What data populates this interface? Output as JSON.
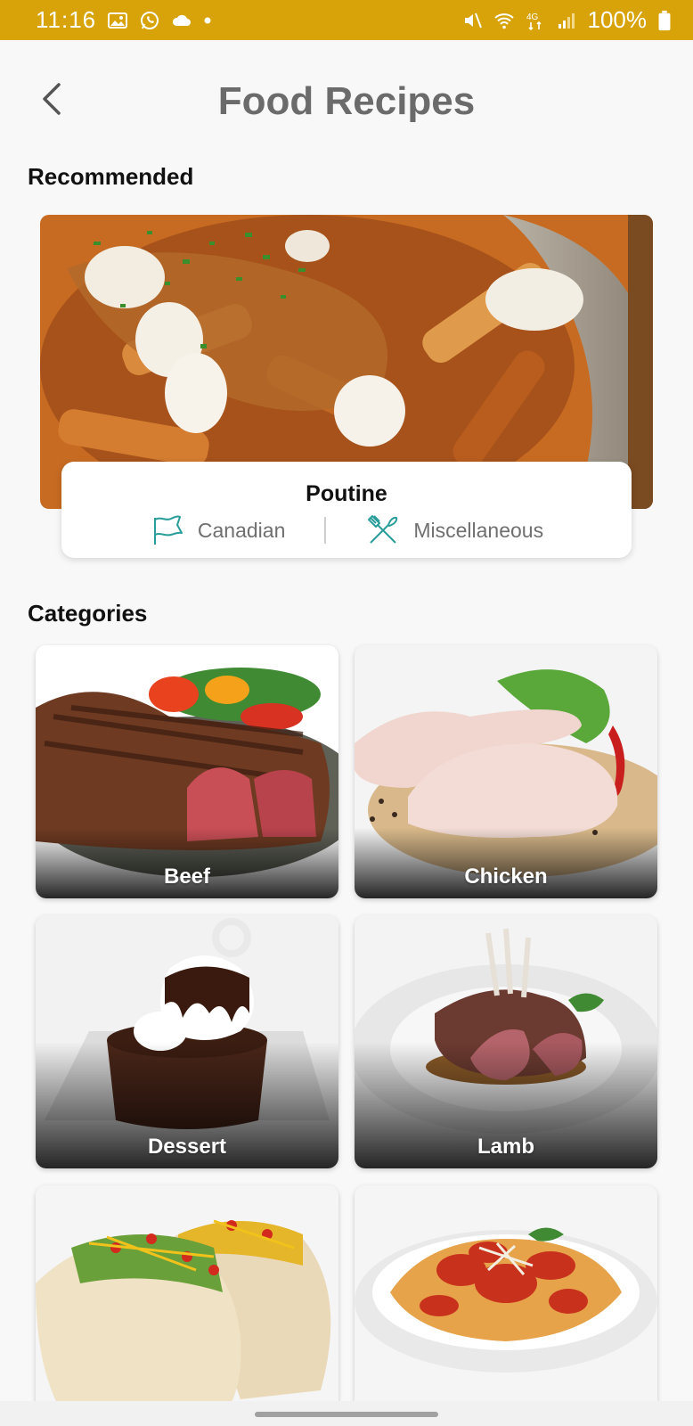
{
  "status_bar": {
    "time": "11:16",
    "battery": "100%",
    "network": "4G",
    "left_icons": [
      "image-icon",
      "whatsapp-icon",
      "cloud-icon",
      "dot-icon"
    ],
    "right_icons": [
      "mute-icon",
      "wifi-icon",
      "network-icon",
      "signal-icon",
      "battery-icon"
    ],
    "color": "#d8a308"
  },
  "header": {
    "title": "Food Recipes",
    "back_icon": "chevron-left-icon"
  },
  "recommended": {
    "heading": "Recommended",
    "name": "Poutine",
    "area": "Canadian",
    "category": "Miscellaneous",
    "area_icon": "flag-icon",
    "category_icon": "utensils-icon"
  },
  "categories": {
    "heading": "Categories",
    "items": [
      {
        "label": "Beef"
      },
      {
        "label": "Chicken"
      },
      {
        "label": "Dessert"
      },
      {
        "label": "Lamb"
      },
      {
        "label": ""
      },
      {
        "label": ""
      }
    ]
  },
  "colors": {
    "accent": "#2a9d9a",
    "title": "#6b6b6b"
  }
}
